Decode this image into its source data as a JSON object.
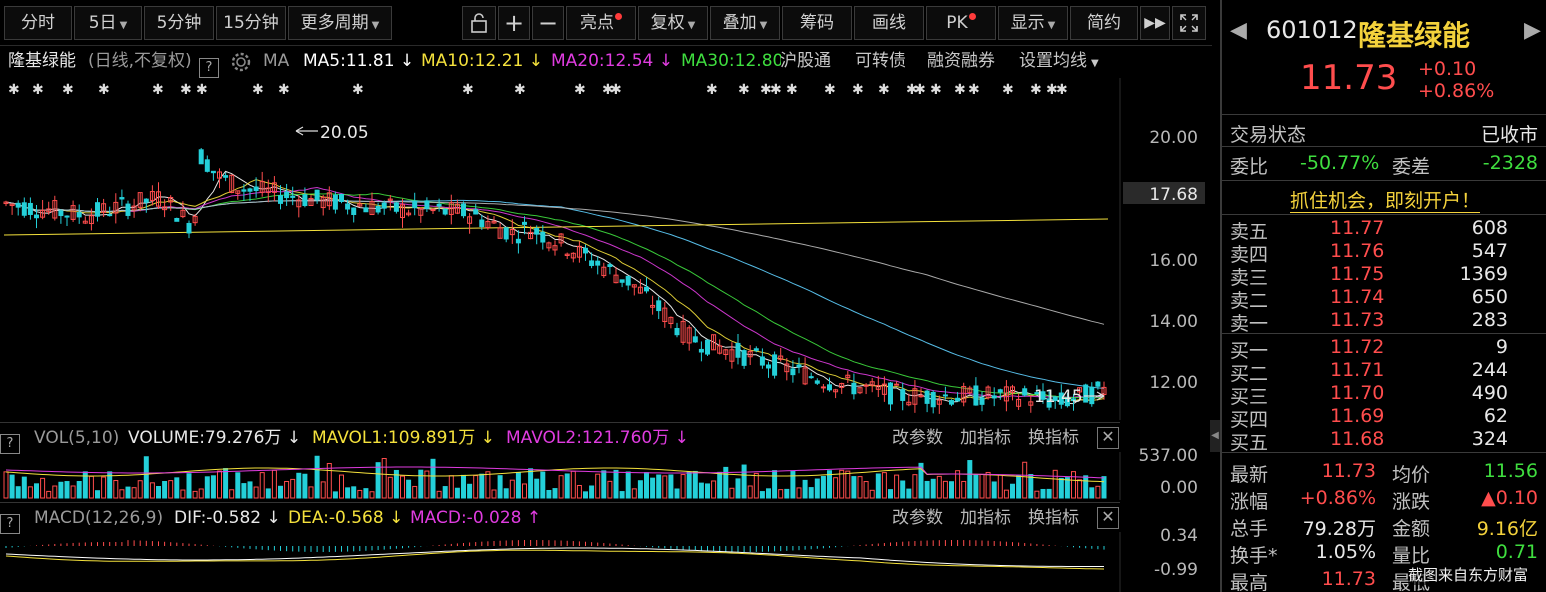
{
  "toolbar": {
    "items": [
      "分时",
      "5日",
      "5分钟",
      "15分钟",
      "更多周期"
    ],
    "icons": [
      "lock-icon",
      "plus-icon",
      "minus-icon"
    ],
    "right": [
      "亮点",
      "复权",
      "叠加",
      "筹码",
      "画线",
      "PK",
      "显示",
      "简约"
    ]
  },
  "info": {
    "name": "隆基绿能",
    "mode": "(日线,不复权)",
    "q": "?",
    "ma": "MA",
    "ma5": "MA5:11.81",
    "ma10": "MA10:12.21",
    "ma20": "MA20:12.54",
    "ma30": "MA30:12.80",
    "arrow": "↓",
    "links": [
      "沪股通",
      "可转债",
      "融资融券",
      "设置均线"
    ]
  },
  "chart": {
    "high_label": "20.05",
    "low_label": "11.45",
    "current_price_tag": "17.68",
    "y_ticks": [
      "20.00",
      "16.00",
      "14.00",
      "12.00"
    ]
  },
  "vol": {
    "q": "?",
    "title": "VOL(5,10)",
    "volume": "VOLUME:79.276万",
    "mavol1": "MAVOL1:109.891万",
    "mavol2": "MAVOL2:121.760万",
    "arrow": "↓",
    "actions": [
      "改参数",
      "加指标",
      "换指标"
    ],
    "y_ticks": [
      "537.00",
      "0.00"
    ]
  },
  "macd": {
    "q": "?",
    "title": "MACD(12,26,9)",
    "dif": "DIF:-0.582",
    "dea": "DEA:-0.568",
    "macd": "MACD:-0.028",
    "down": "↓",
    "up": "↑",
    "actions": [
      "改参数",
      "加指标",
      "换指标"
    ],
    "y_ticks": [
      "0.34",
      "-0.99"
    ]
  },
  "quote": {
    "code": "601012",
    "name": "隆基绿能",
    "price": "11.73",
    "change": "+0.10",
    "change_pct": "+0.86%",
    "status_label": "交易状态",
    "status": "已收市",
    "wb_label": "委比",
    "wb": "-50.77%",
    "wc_label": "委差",
    "wc": "-2328",
    "promo": "抓住机会，即刻开户！",
    "asks": [
      {
        "label": "卖五",
        "price": "11.77",
        "vol": "608"
      },
      {
        "label": "卖四",
        "price": "11.76",
        "vol": "547"
      },
      {
        "label": "卖三",
        "price": "11.75",
        "vol": "1369"
      },
      {
        "label": "卖二",
        "price": "11.74",
        "vol": "650"
      },
      {
        "label": "卖一",
        "price": "11.73",
        "vol": "283"
      }
    ],
    "bids": [
      {
        "label": "买一",
        "price": "11.72",
        "vol": "9"
      },
      {
        "label": "买二",
        "price": "11.71",
        "vol": "244"
      },
      {
        "label": "买三",
        "price": "11.70",
        "vol": "490"
      },
      {
        "label": "买四",
        "price": "11.69",
        "vol": "62"
      },
      {
        "label": "买五",
        "price": "11.68",
        "vol": "324"
      }
    ],
    "stats": [
      {
        "l1": "最新",
        "v1": "11.73",
        "c1": "red",
        "l2": "均价",
        "v2": "11.56",
        "c2": "green"
      },
      {
        "l1": "涨幅",
        "v1": "+0.86%",
        "c1": "red",
        "l2": "涨跌",
        "v2": "▲0.10",
        "c2": "red"
      },
      {
        "l1": "总手",
        "v1": "79.28万",
        "c1": "white",
        "l2": "金额",
        "v2": "9.16亿",
        "c2": "yellow"
      },
      {
        "l1": "换手*",
        "v1": "1.05%",
        "c1": "white",
        "l2": "量比",
        "v2": "0.71",
        "c2": "green"
      },
      {
        "l1": "最高",
        "v1": "11.73",
        "c1": "red",
        "l2": "最低",
        "v2": "",
        "c2": "green"
      }
    ],
    "watermark": "截图来自东方财富"
  },
  "colors": {
    "up": "#ff4d4d",
    "down": "#24d0d9",
    "ma5": "#ffffff",
    "ma10": "#f4e13c",
    "ma20": "#e03ce0",
    "ma30": "#3fde3f"
  }
}
